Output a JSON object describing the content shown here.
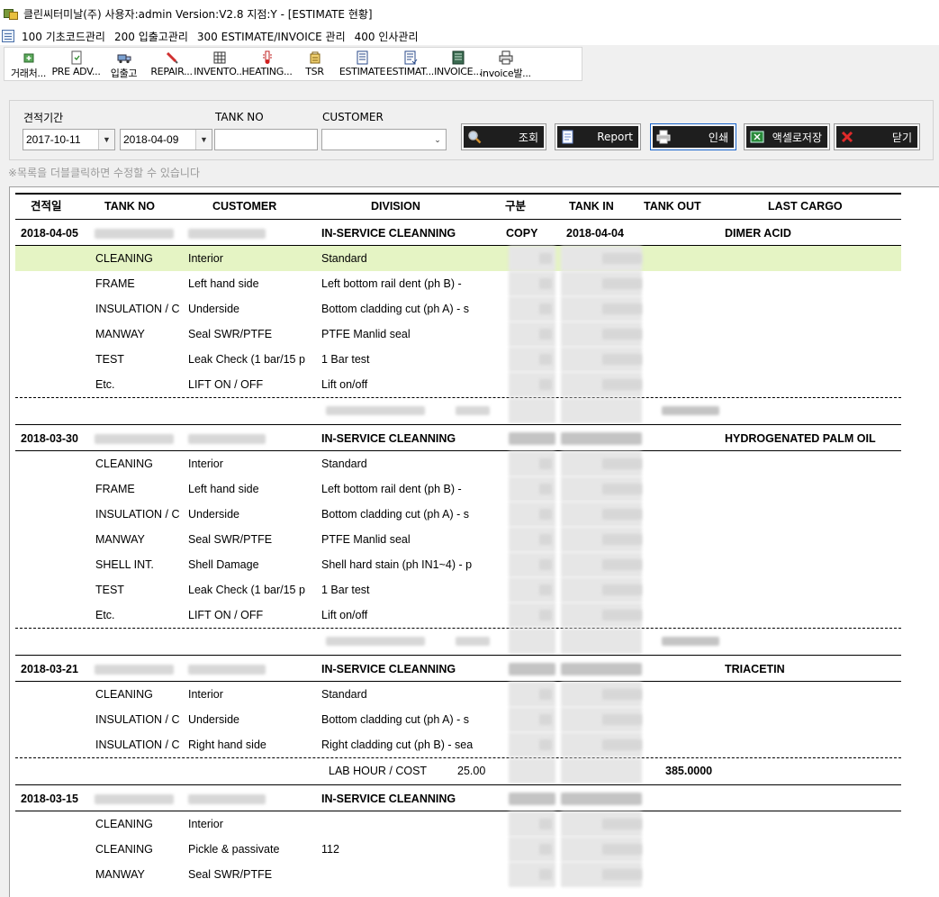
{
  "window": {
    "title": "클린씨터미날(주) 사용자:admin Version:V2.8 지점:Y - [ESTIMATE 현황]"
  },
  "menu": [
    "100 기초코드관리",
    "200 입출고관리",
    "300 ESTIMATE/INVOICE 관리",
    "400 인사관리"
  ],
  "toolbar": [
    {
      "label": "거래처...",
      "icon": "partner-add-icon"
    },
    {
      "label": "PRE ADV...",
      "icon": "pre-advice-icon"
    },
    {
      "label": "입출고",
      "icon": "truck-icon"
    },
    {
      "label": "REPAIR...",
      "icon": "repair-pencil-icon"
    },
    {
      "label": "INVENTO...",
      "icon": "inventory-grid-icon"
    },
    {
      "label": "HEATING...",
      "icon": "heating-icon"
    },
    {
      "label": "TSR",
      "icon": "tsr-icon"
    },
    {
      "label": "ESTIMATE",
      "icon": "estimate-doc-icon"
    },
    {
      "label": "ESTIMAT...",
      "icon": "estimate-list-icon"
    },
    {
      "label": "INVOICE...",
      "icon": "invoice-icon"
    },
    {
      "label": "invoice발...",
      "icon": "printer-icon"
    }
  ],
  "filter": {
    "period_label": "견적기간",
    "date_from": "2017-10-11",
    "date_to": "2018-04-09",
    "tank_no_label": "TANK NO",
    "tank_no_value": "",
    "customer_label": "CUSTOMER",
    "customer_value": ""
  },
  "actions": [
    {
      "label": "조회",
      "icon": "search-icon"
    },
    {
      "label": "Report",
      "icon": "report-doc-icon"
    },
    {
      "label": "인쇄",
      "icon": "printer-icon"
    },
    {
      "label": "액셀로저장",
      "icon": "excel-icon"
    },
    {
      "label": "닫기",
      "icon": "close-x-icon"
    }
  ],
  "hint": "※목록을 더블클릭하면 수정할 수 있습니다",
  "columns": [
    "견적일",
    "TANK NO",
    "CUSTOMER",
    "DIVISION",
    "구분",
    "TANK IN",
    "TANK OUT",
    "LAST CARGO"
  ],
  "groups": [
    {
      "date": "2018-04-05",
      "division": "IN-SERVICE CLEANNING",
      "gubun": "COPY",
      "tank_in": "2018-04-04",
      "last_cargo": "DIMER ACID",
      "items": [
        [
          "CLEANING",
          "Interior",
          "Standard"
        ],
        [
          "FRAME",
          "Left hand side",
          "Left bottom rail dent (ph B) - "
        ],
        [
          "INSULATION / C",
          "Underside",
          "Bottom cladding cut (ph A) - s"
        ],
        [
          "MANWAY",
          "Seal SWR/PTFE",
          "PTFE Manlid seal"
        ],
        [
          "TEST",
          "Leak Check (1 bar/15 p",
          "1 Bar test"
        ],
        [
          "Etc.",
          "LIFT ON / OFF",
          "Lift on/off"
        ]
      ],
      "footer": {
        "label": "",
        "hours": "",
        "cost": ""
      }
    },
    {
      "date": "2018-03-30",
      "division": "IN-SERVICE CLEANNING",
      "gubun": "",
      "tank_in": "",
      "last_cargo": "HYDROGENATED PALM OIL",
      "items": [
        [
          "CLEANING",
          "Interior",
          "Standard"
        ],
        [
          "FRAME",
          "Left hand side",
          "Left bottom rail dent (ph B) - "
        ],
        [
          "INSULATION / C",
          "Underside",
          "Bottom cladding cut (ph A) - s"
        ],
        [
          "MANWAY",
          "Seal SWR/PTFE",
          "PTFE Manlid seal"
        ],
        [
          "SHELL INT.",
          "Shell Damage",
          "Shell hard stain (ph IN1~4) - p"
        ],
        [
          "TEST",
          "Leak Check (1 bar/15 p",
          "1 Bar test"
        ],
        [
          "Etc.",
          "LIFT ON / OFF",
          "Lift on/off"
        ]
      ],
      "footer": {
        "label": "",
        "hours": "",
        "cost": ""
      }
    },
    {
      "date": "2018-03-21",
      "division": "IN-SERVICE CLEANNING",
      "gubun": "",
      "tank_in": "",
      "last_cargo": "TRIACETIN",
      "items": [
        [
          "CLEANING",
          "Interior",
          "Standard"
        ],
        [
          "INSULATION / C",
          "Underside",
          "Bottom cladding cut (ph A) - s"
        ],
        [
          "INSULATION / C",
          "Right hand side",
          "Right cladding cut (ph B) - sea"
        ]
      ],
      "footer": {
        "label": "LAB HOUR / COST",
        "hours": "25.00",
        "cost": "385.0000"
      }
    },
    {
      "date": "2018-03-15",
      "division": "IN-SERVICE CLEANNING",
      "gubun": "",
      "tank_in": "",
      "last_cargo": "",
      "items": [
        [
          "CLEANING",
          "Interior",
          ""
        ],
        [
          "CLEANING",
          "Pickle & passivate",
          "112"
        ],
        [
          "MANWAY",
          "Seal SWR/PTFE",
          ""
        ]
      ],
      "footer": null
    }
  ]
}
